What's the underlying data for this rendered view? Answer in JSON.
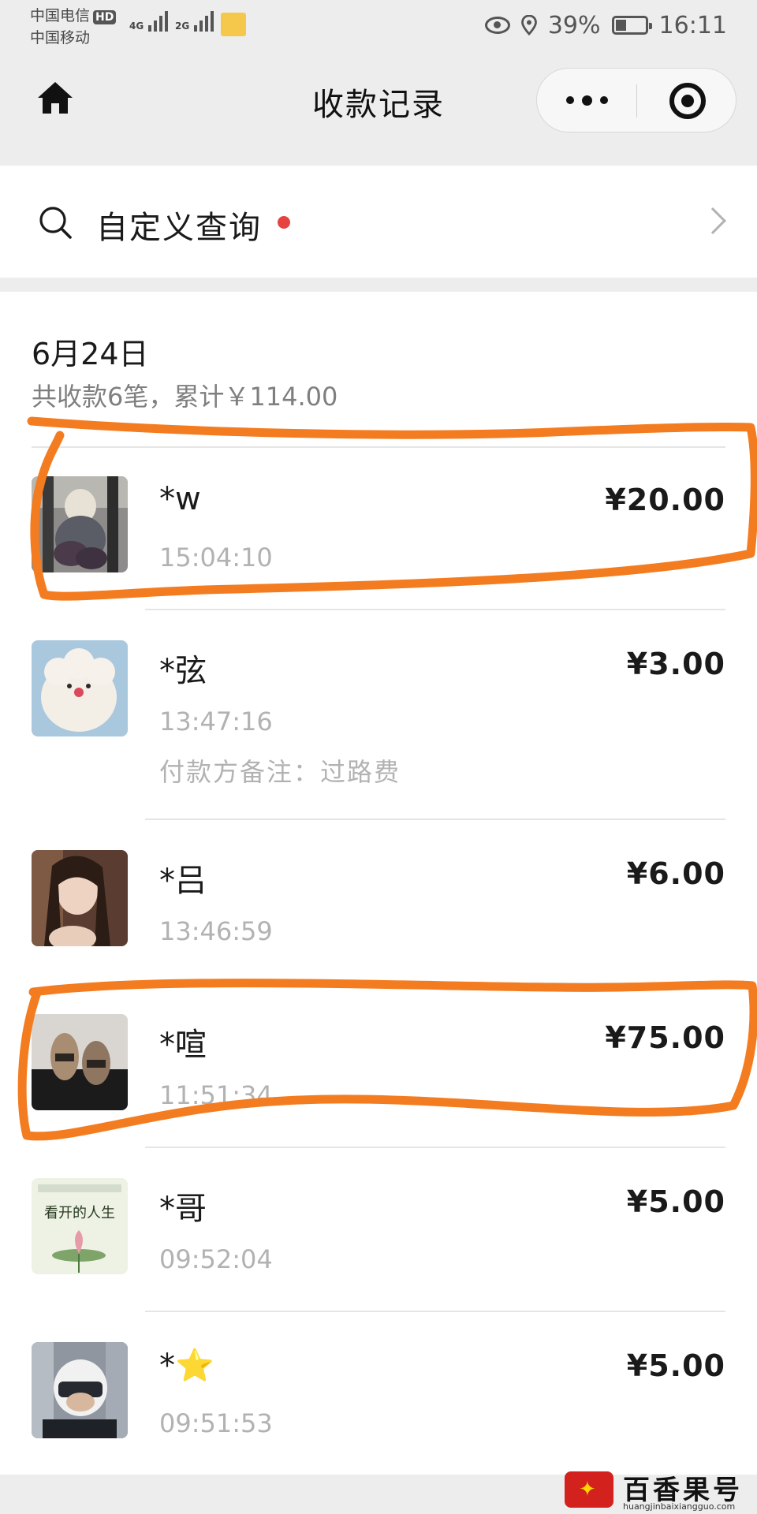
{
  "status_bar": {
    "carrier_1": "中国电信",
    "hd": "HD",
    "carrier_2": "中国移动",
    "net_1": "4G",
    "net_2": "2G",
    "battery": "39%",
    "time": "16:11"
  },
  "title_bar": {
    "title": "收款记录"
  },
  "search": {
    "label": "自定义查询"
  },
  "day": {
    "date": "6月24日",
    "summary": "共收款6笔，累计￥114.00"
  },
  "records": [
    {
      "payer": "*w",
      "time": "15:04:10",
      "amount": "¥20.00",
      "remark": ""
    },
    {
      "payer": "*弦",
      "time": "13:47:16",
      "amount": "¥3.00",
      "remark": "付款方备注：过路费"
    },
    {
      "payer": "*吕",
      "time": "13:46:59",
      "amount": "¥6.00",
      "remark": ""
    },
    {
      "payer": "*喧",
      "time": "11:51:34",
      "amount": "¥75.00",
      "remark": ""
    },
    {
      "payer": "*哥",
      "time": "09:52:04",
      "amount": "¥5.00",
      "remark": ""
    },
    {
      "payer": "*⭐",
      "time": "09:51:53",
      "amount": "¥5.00",
      "remark": ""
    }
  ],
  "avatar_5_caption": "看开的人生",
  "watermark": {
    "text": "百香果号",
    "url": "huangjinbaixiangguo.com"
  },
  "colors": {
    "background": "#ededed",
    "red_dot": "#e64340",
    "annotation_stroke": "#f47c20"
  }
}
